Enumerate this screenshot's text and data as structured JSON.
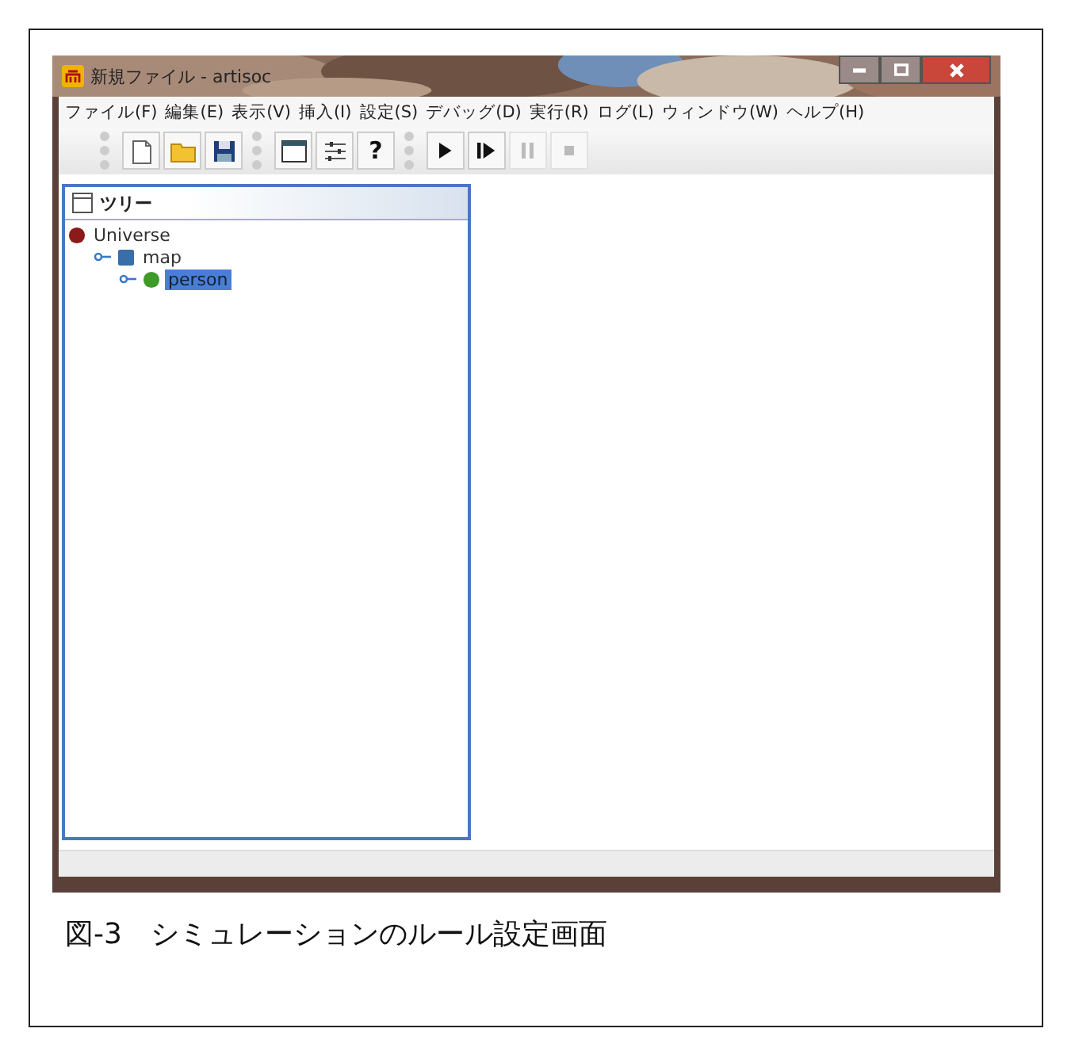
{
  "window": {
    "title": "新規ファイル - artisoc"
  },
  "menu": [
    "ファイル(F)",
    "編集(E)",
    "表示(V)",
    "挿入(I)",
    "設定(S)",
    "デバッグ(D)",
    "実行(R)",
    "ログ(L)",
    "ウィンドウ(W)",
    "ヘルプ(H)"
  ],
  "toolbar": [
    [
      {
        "kind": "new",
        "disabled": false
      },
      {
        "kind": "open",
        "disabled": false
      },
      {
        "kind": "save",
        "disabled": false
      }
    ],
    [
      {
        "kind": "window",
        "disabled": false
      },
      {
        "kind": "sliders",
        "disabled": false
      },
      {
        "kind": "text",
        "label": "?",
        "disabled": false
      }
    ],
    [
      {
        "kind": "play",
        "disabled": false
      },
      {
        "kind": "step",
        "disabled": false
      },
      {
        "kind": "pause",
        "disabled": true
      },
      {
        "kind": "stop",
        "disabled": true
      }
    ]
  ],
  "tree_panel": {
    "title": "ツリー",
    "items": [
      {
        "label": "Universe",
        "kind": "ball",
        "color": "#8b1a1a",
        "selected": false,
        "children": [
          {
            "label": "map",
            "kind": "square",
            "color": "#3a6ea8",
            "selected": false,
            "children": [
              {
                "label": "person",
                "kind": "ball",
                "color": "#3f9a2a",
                "selected": true
              }
            ]
          }
        ]
      }
    ]
  },
  "caption": "図-3　シミュレーションのルール設定画面"
}
